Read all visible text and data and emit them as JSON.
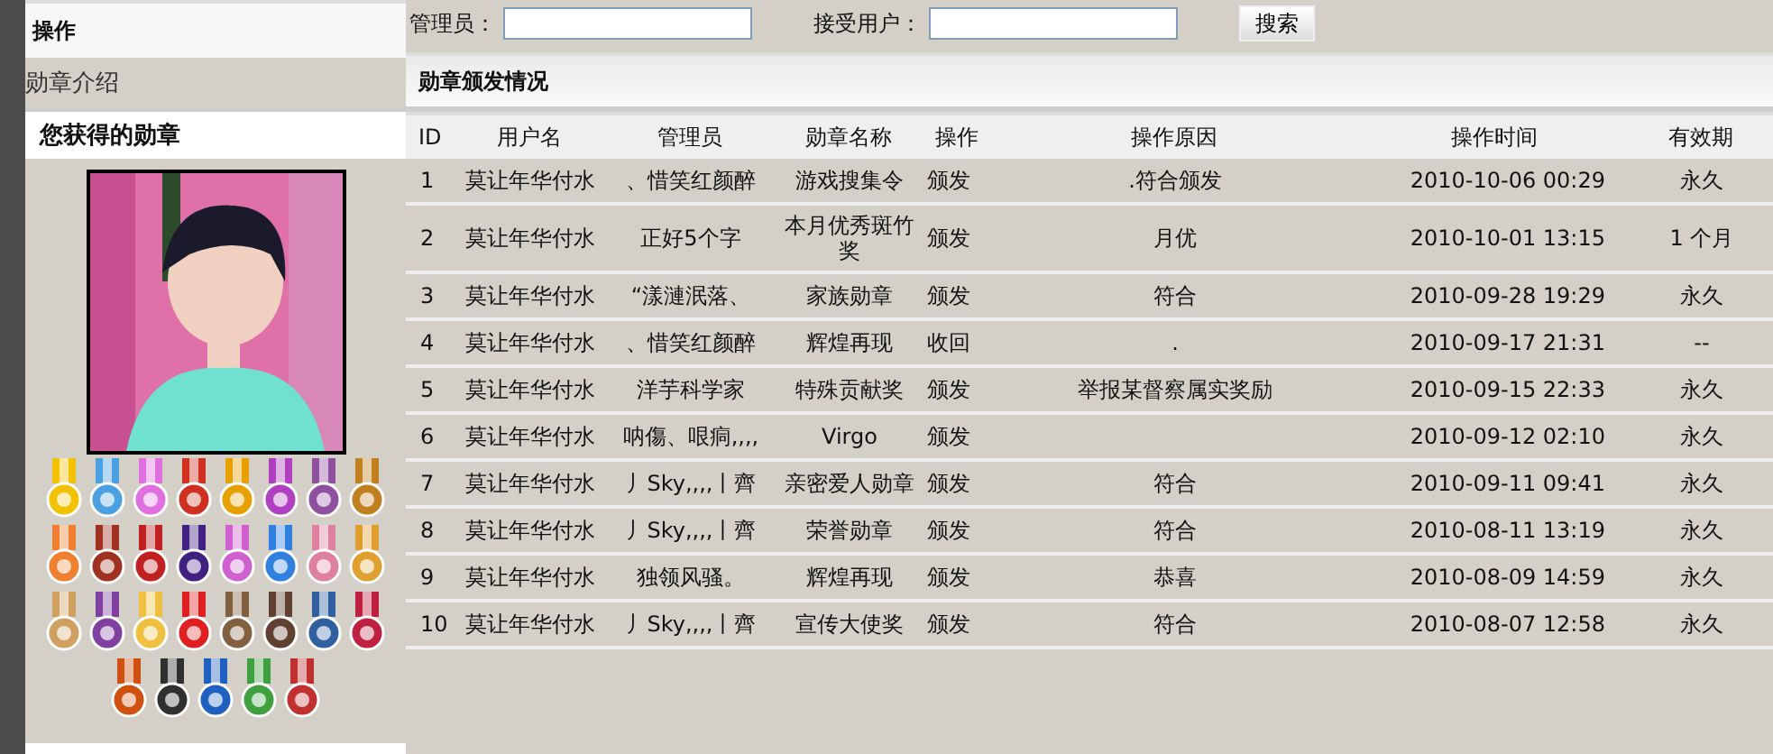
{
  "sidebar": {
    "header": "操作",
    "items": [
      {
        "label": "勋章介绍"
      }
    ]
  },
  "medals_panel": {
    "title": "您获得的勋章"
  },
  "search": {
    "fields": [
      {
        "label": "管理员："
      },
      {
        "label": "接受用户："
      }
    ],
    "button": "搜索"
  },
  "table": {
    "title": "勋章颁发情况",
    "columns": [
      "ID",
      "用户名",
      "管理员",
      "勋章名称",
      "操作",
      "操作原因",
      "操作时间",
      "有效期"
    ],
    "rows": [
      [
        "1",
        "莫让年华付水",
        "、惜笑红颜醉",
        "游戏搜集令",
        "颁发",
        ".符合颁发",
        "2010-10-06 00:29",
        "永久"
      ],
      [
        "2",
        "莫让年华付水",
        "正好5个字",
        "本月优秀斑竹奖",
        "颁发",
        "月优",
        "2010-10-01 13:15",
        "1 个月"
      ],
      [
        "3",
        "莫让年华付水",
        "“漾漣泯落、",
        "家族勋章",
        "颁发",
        "符合",
        "2010-09-28 19:29",
        "永久"
      ],
      [
        "4",
        "莫让年华付水",
        "、惜笑红颜醉",
        "辉煌再现",
        "收回",
        ".",
        "2010-09-17 21:31",
        "--"
      ],
      [
        "5",
        "莫让年华付水",
        "洋芋科学家",
        "特殊贡献奖",
        "颁发",
        "举报某督察属实奖励",
        "2010-09-15 22:33",
        "永久"
      ],
      [
        "6",
        "莫让年华付水",
        "呐傷、哏痌,,,,",
        "Virgo",
        "颁发",
        "",
        "2010-09-12 02:10",
        "永久"
      ],
      [
        "7",
        "莫让年华付水",
        "丿Sky,,,,丨齊",
        "亲密爱人勋章",
        "颁发",
        "符合",
        "2010-09-11 09:41",
        "永久"
      ],
      [
        "8",
        "莫让年华付水",
        "丿Sky,,,,丨齊",
        "荣誉勋章",
        "颁发",
        "符合",
        "2010-08-11 13:19",
        "永久"
      ],
      [
        "9",
        "莫让年华付水",
        "独领风骚。",
        "辉煌再现",
        "颁发",
        "恭喜",
        "2010-08-09 14:59",
        "永久"
      ],
      [
        "10",
        "莫让年华付水",
        "丿Sky,,,,丨齊",
        "宣传大使奖",
        "颁发",
        "符合",
        "2010-08-07 12:58",
        "永久"
      ]
    ]
  }
}
